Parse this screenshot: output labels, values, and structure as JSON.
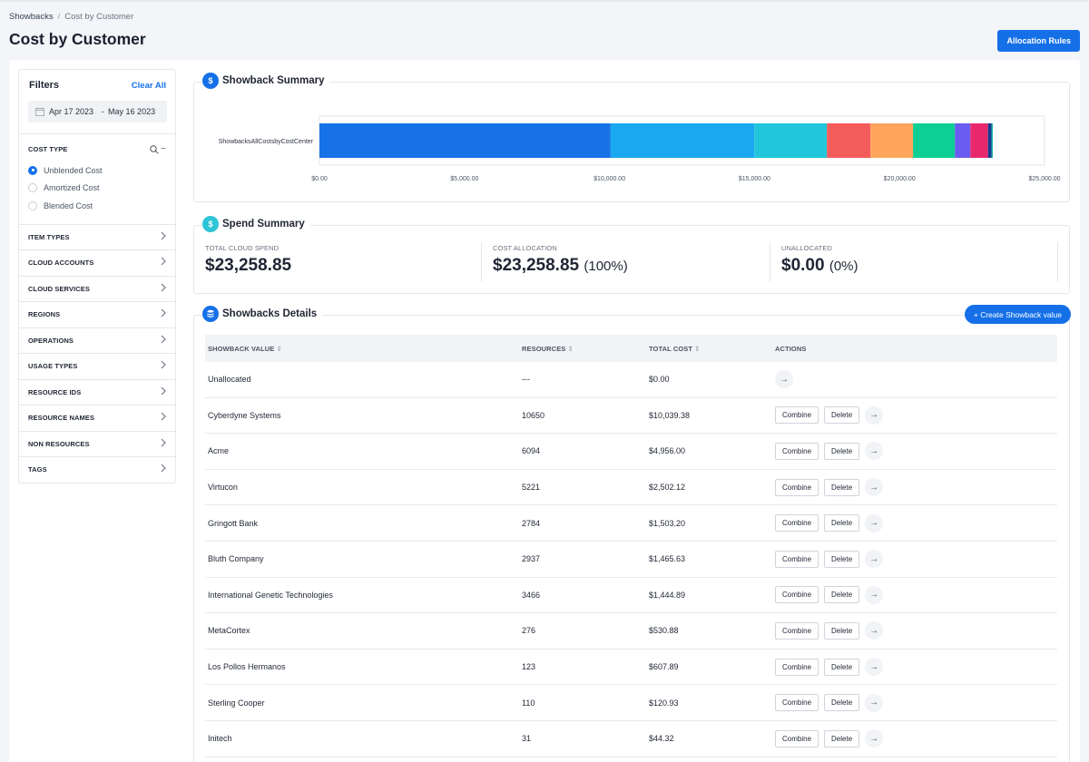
{
  "breadcrumb": {
    "root": "Showbacks",
    "separator": "/",
    "current": "Cost by Customer"
  },
  "page_title": "Cost by Customer",
  "allocation_rules_label": "Allocation Rules",
  "filters": {
    "title": "Filters",
    "clear_all": "Clear All",
    "date_start": "Apr 17 2023",
    "date_end": "May 16 2023",
    "date_separator": "-",
    "cost_type_label": "COST TYPE",
    "cost_types": [
      {
        "label": "Unblended Cost",
        "selected": true
      },
      {
        "label": "Amortized Cost",
        "selected": false
      },
      {
        "label": "Blended Cost",
        "selected": false
      }
    ],
    "categories": [
      "ITEM TYPES",
      "CLOUD ACCOUNTS",
      "CLOUD SERVICES",
      "REGIONS",
      "OPERATIONS",
      "USAGE TYPES",
      "RESOURCE IDS",
      "RESOURCE NAMES",
      "NON RESOURCES",
      "TAGS"
    ]
  },
  "showback_summary": {
    "title": "Showback Summary",
    "icon": "dollar-icon"
  },
  "chart_data": {
    "type": "bar",
    "orientation": "horizontal-stacked",
    "categories": [
      "ShowbacksAllCostsbyCostCenter"
    ],
    "series": [
      {
        "values": [
          10039.38
        ],
        "color": "#1672e6"
      },
      {
        "values": [
          4956.0
        ],
        "color": "#1aa8f0"
      },
      {
        "values": [
          2502.12
        ],
        "color": "#21c6dc"
      },
      {
        "values": [
          1503.2
        ],
        "color": "#f45b5b"
      },
      {
        "values": [
          1465.63
        ],
        "color": "#fca55b"
      },
      {
        "values": [
          1444.89
        ],
        "color": "#0ecf93"
      },
      {
        "values": [
          530.88
        ],
        "color": "#6a5cf0"
      },
      {
        "values": [
          607.89
        ],
        "color": "#e8276d"
      },
      {
        "values": [
          120.93
        ],
        "color": "#1a3a8f"
      },
      {
        "values": [
          44.32
        ],
        "color": "#12b3a8"
      }
    ],
    "xlim": [
      0,
      25000
    ],
    "xticks": [
      "$0.00",
      "$5,000.00",
      "$10,000.00",
      "$15,000.00",
      "$20,000.00",
      "$25,000.00"
    ],
    "grid": false
  },
  "spend_summary": {
    "title": "Spend Summary",
    "total_label": "TOTAL CLOUD SPEND",
    "total_value": "$23,258.85",
    "allocation_label": "COST ALLOCATION",
    "allocation_value": "$23,258.85",
    "allocation_pct": "(100%)",
    "unallocated_label": "UNALLOCATED",
    "unallocated_value": "$0.00",
    "unallocated_pct": "(0%)"
  },
  "details": {
    "title": "Showbacks Details",
    "create_label": "+ Create Showback value",
    "columns": [
      "SHOWBACK VALUE",
      "RESOURCES",
      "TOTAL COST",
      "ACTIONS"
    ],
    "combine_label": "Combine",
    "delete_label": "Delete",
    "rows": [
      {
        "name": "Unallocated",
        "resources": "---",
        "cost": "$0.00",
        "actions": false
      },
      {
        "name": "Cyberdyne Systems",
        "resources": "10650",
        "cost": "$10,039.38",
        "actions": true
      },
      {
        "name": "Acme",
        "resources": "6094",
        "cost": "$4,956.00",
        "actions": true
      },
      {
        "name": "Virtucon",
        "resources": "5221",
        "cost": "$2,502.12",
        "actions": true
      },
      {
        "name": "Gringott Bank",
        "resources": "2784",
        "cost": "$1,503.20",
        "actions": true
      },
      {
        "name": "Bluth Company",
        "resources": "2937",
        "cost": "$1,465.63",
        "actions": true
      },
      {
        "name": "International Genetic Technologies",
        "resources": "3466",
        "cost": "$1,444.89",
        "actions": true
      },
      {
        "name": "MetaCortex",
        "resources": "276",
        "cost": "$530.88",
        "actions": true
      },
      {
        "name": "Los Pollos Hermanos",
        "resources": "123",
        "cost": "$607.89",
        "actions": true
      },
      {
        "name": "Sterling Cooper",
        "resources": "110",
        "cost": "$120.93",
        "actions": true
      },
      {
        "name": "Initech",
        "resources": "31",
        "cost": "$44.32",
        "actions": true
      }
    ]
  }
}
